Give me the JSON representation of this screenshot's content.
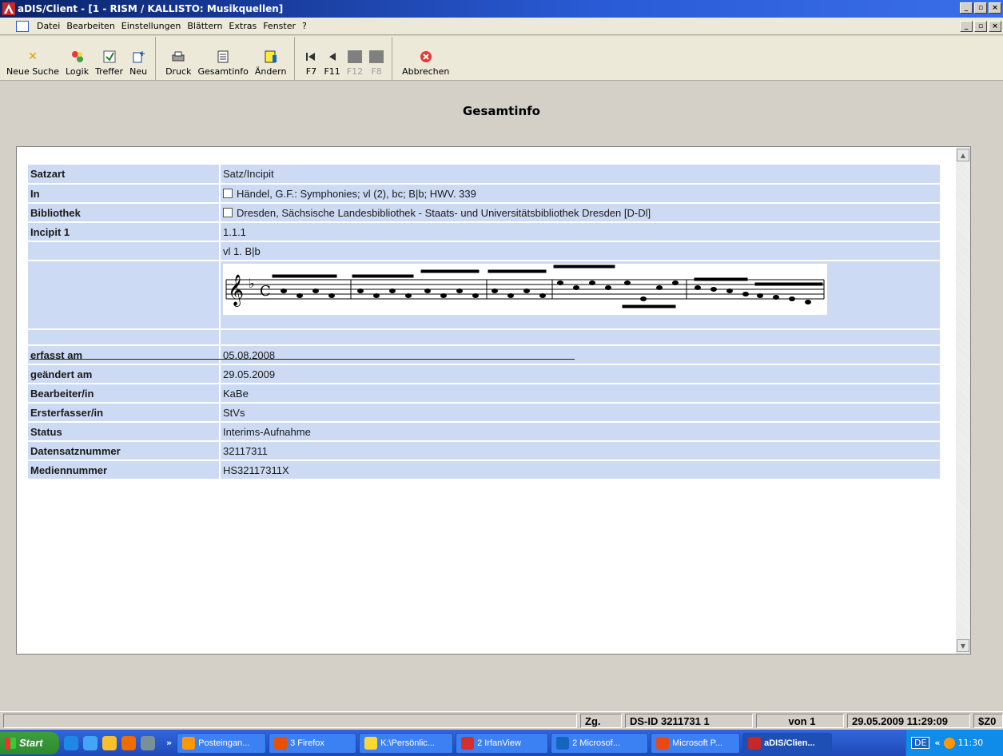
{
  "window": {
    "title": "aDIS/Client - [1 - RISM / KALLISTO: Musikquellen]",
    "title_buttons": [
      "_",
      "8",
      ""
    ]
  },
  "menu": [
    "Datei",
    "Bearbeiten",
    "Einstellungen",
    "Blättern",
    "Extras",
    "Fenster",
    "?"
  ],
  "toolbar": {
    "group1": [
      {
        "label": "Neue Suche",
        "icon": "x-icon"
      },
      {
        "label": "Logik",
        "icon": "logic-icon"
      },
      {
        "label": "Treffer",
        "icon": "hits-icon"
      },
      {
        "label": "Neu",
        "icon": "new-icon"
      }
    ],
    "group2": [
      {
        "label": "Druck",
        "icon": "print-icon"
      },
      {
        "label": "Gesamtinfo",
        "icon": "info-icon"
      },
      {
        "label": "Ändern",
        "icon": "edit-icon"
      }
    ],
    "group3": [
      {
        "label": "F7",
        "icon": "first-icon",
        "disabled": false
      },
      {
        "label": "F11",
        "icon": "prev-icon",
        "disabled": false
      },
      {
        "label": "F12",
        "icon": "next-icon",
        "disabled": true
      },
      {
        "label": "F8",
        "icon": "last-icon",
        "disabled": true
      }
    ],
    "group4": [
      {
        "label": "Abbrechen",
        "icon": "cancel-icon"
      }
    ]
  },
  "page_title": "Gesamtinfo",
  "record": {
    "satzart_label": "Satzart",
    "satzart": "Satz/Incipit",
    "in_label": "In",
    "in": "Händel, G.F.: Symphonies;  vl (2), bc;  B|b; HWV. 339",
    "bib_label": "Bibliothek",
    "bib": "Dresden,  Sächsische Landesbibliothek - Staats- und Universitätsbibliothek Dresden [D-Dl]",
    "incipit_label": "Incipit 1",
    "incipit_num": "1.1.1",
    "incipit_instr": "vl 1. B|b",
    "fields": [
      {
        "label": "erfasst am",
        "value": "05.08.2008"
      },
      {
        "label": "geändert am",
        "value": "29.05.2009"
      },
      {
        "label": "Bearbeiter/in",
        "value": "KaBe"
      },
      {
        "label": "Ersterfasser/in",
        "value": "StVs"
      },
      {
        "label": "Status",
        "value": "Interims-Aufnahme"
      },
      {
        "label": "Datensatznummer",
        "value": "32117311"
      },
      {
        "label": "Mediennummer",
        "value": "HS32117311X"
      }
    ]
  },
  "status": {
    "zg": "Zg.",
    "dsid": "DS-ID 3211731  1",
    "von": "von 1",
    "datetime": "29.05.2009 11:29:09",
    "z": "$Z0"
  },
  "taskbar": {
    "start": "Start",
    "chevron": "»",
    "tasks": [
      "Posteingan...",
      "3 Firefox",
      "K:\\Persönlic...",
      "2 IrfanView",
      "2 Microsof...",
      "Microsoft P...",
      "aDIS/Clien..."
    ],
    "lang": "DE",
    "tray_chevron": "«",
    "clock": "11:30"
  }
}
